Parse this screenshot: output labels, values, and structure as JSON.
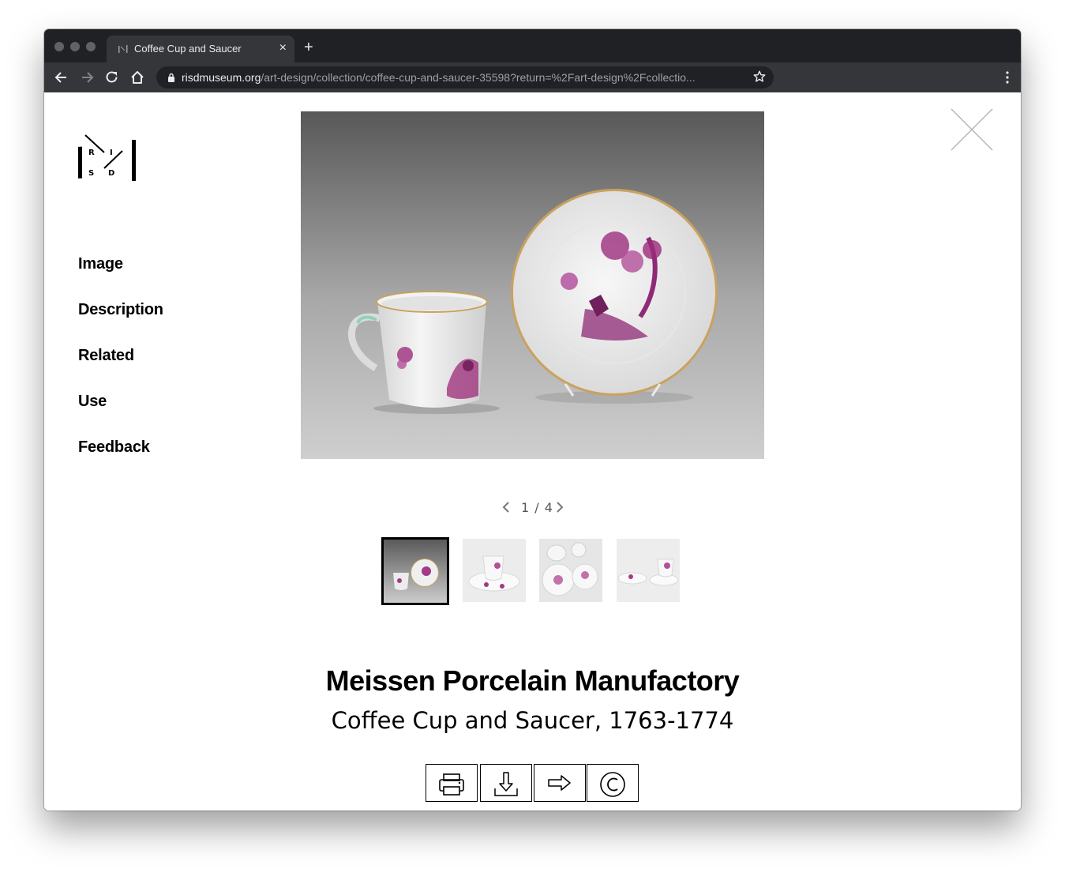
{
  "browser": {
    "tab_title": "Coffee Cup and Saucer",
    "new_tab_label": "+",
    "close_tab_label": "×",
    "url_domain": "risdmuseum.org",
    "url_path": "/art-design/collection/coffee-cup-and-saucer-35598?return=%2Fart-design%2Fcollectio..."
  },
  "logo": {
    "letters": [
      "R",
      "I",
      "S",
      "D"
    ]
  },
  "sidenav": {
    "items": [
      {
        "label": "Image"
      },
      {
        "label": "Description"
      },
      {
        "label": "Related"
      },
      {
        "label": "Use"
      },
      {
        "label": "Feedback"
      }
    ]
  },
  "viewer": {
    "pager_text": "1 / 4",
    "current_index": 1,
    "total": 4
  },
  "object": {
    "artist": "Meissen Porcelain Manufactory",
    "title_line": "Coffee Cup and Saucer, 1763-1774"
  },
  "actions": [
    {
      "icon": "print-icon"
    },
    {
      "icon": "download-icon"
    },
    {
      "icon": "share-arrow-icon"
    },
    {
      "icon": "copyright-icon"
    }
  ],
  "colors": {
    "chrome_dark": "#202124",
    "chrome_toolbar": "#35363a",
    "porcelain_magenta": "#9c2a7a",
    "gilt_rim": "#c9a25e"
  }
}
